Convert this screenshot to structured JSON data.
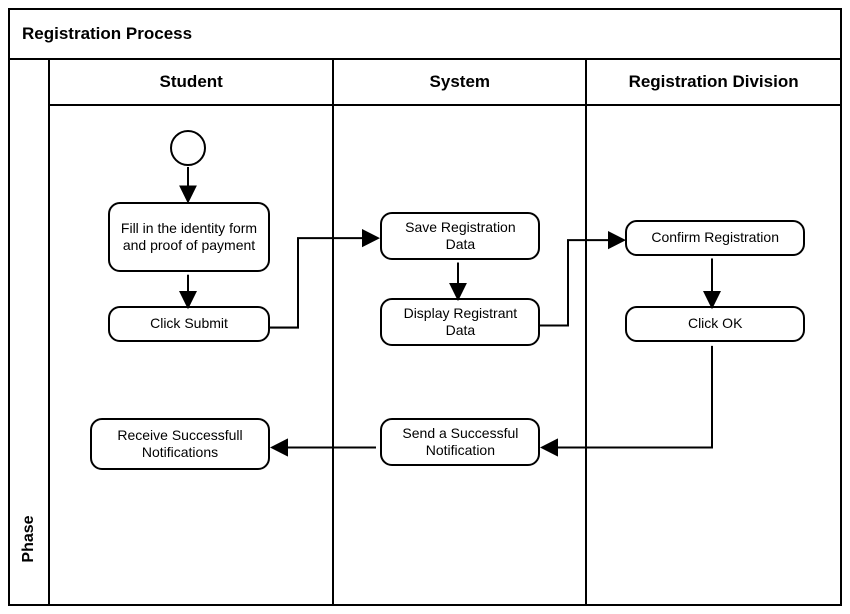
{
  "title": "Registration Process",
  "phase_label": "Phase",
  "lanes": {
    "student": "Student",
    "system": "System",
    "registration": "Registration Division"
  },
  "activities": {
    "fill_form": "Fill in the identity form and proof of payment",
    "click_submit": "Click Submit",
    "save_data": "Save Registration Data",
    "display_data": "Display Registrant Data",
    "confirm_reg": "Confirm Registration",
    "click_ok": "Click OK",
    "send_notif": "Send a Successful Notification",
    "receive_notif": "Receive Successfull Notifications"
  },
  "chart_data": {
    "type": "activity-swimlane",
    "title": "Registration Process",
    "lanes": [
      "Student",
      "System",
      "Registration Division"
    ],
    "nodes": [
      {
        "id": "start",
        "type": "initial",
        "lane": "Student"
      },
      {
        "id": "fill_form",
        "type": "activity",
        "lane": "Student",
        "label": "Fill in the identity form and proof of payment"
      },
      {
        "id": "click_submit",
        "type": "activity",
        "lane": "Student",
        "label": "Click Submit"
      },
      {
        "id": "save_data",
        "type": "activity",
        "lane": "System",
        "label": "Save Registration Data"
      },
      {
        "id": "display_data",
        "type": "activity",
        "lane": "System",
        "label": "Display Registrant Data"
      },
      {
        "id": "confirm_reg",
        "type": "activity",
        "lane": "Registration Division",
        "label": "Confirm Registration"
      },
      {
        "id": "click_ok",
        "type": "activity",
        "lane": "Registration Division",
        "label": "Click OK"
      },
      {
        "id": "send_notif",
        "type": "activity",
        "lane": "System",
        "label": "Send a Successful Notification"
      },
      {
        "id": "receive_notif",
        "type": "activity",
        "lane": "Student",
        "label": "Receive Successfull Notifications"
      }
    ],
    "edges": [
      {
        "from": "start",
        "to": "fill_form"
      },
      {
        "from": "fill_form",
        "to": "click_submit"
      },
      {
        "from": "click_submit",
        "to": "save_data"
      },
      {
        "from": "save_data",
        "to": "display_data"
      },
      {
        "from": "display_data",
        "to": "confirm_reg"
      },
      {
        "from": "confirm_reg",
        "to": "click_ok"
      },
      {
        "from": "click_ok",
        "to": "send_notif"
      },
      {
        "from": "send_notif",
        "to": "receive_notif"
      }
    ]
  }
}
